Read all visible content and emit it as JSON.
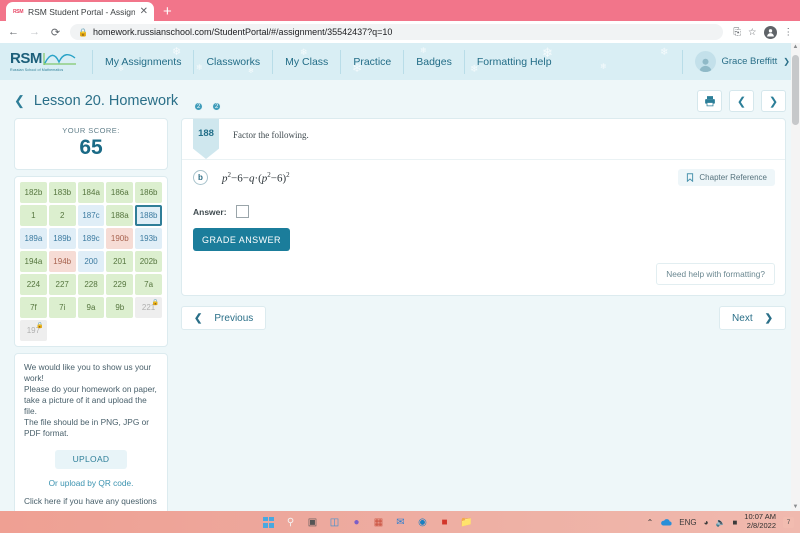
{
  "browser": {
    "tab_title": "RSM Student Portal - Assignment",
    "tab_favicon_text": "RSM",
    "tab_close_glyph": "✕",
    "new_tab_glyph": "+",
    "back_glyph": "←",
    "forward_glyph": "→",
    "reload_glyph": "⟳",
    "lock_glyph": "🔒",
    "url": "homework.russianschool.com/StudentPortal/#/assignment/35542437?q=10",
    "share_glyph": "⎘",
    "bookmark_glyph": "☆",
    "menu_glyph": "⋮"
  },
  "site_nav": {
    "logo_main": "RSM",
    "logo_sub": "Russian School of Mathematics",
    "links": [
      {
        "label": "My Assignments"
      },
      {
        "label": "Classworks"
      },
      {
        "label": "My Class"
      },
      {
        "label": "Practice"
      },
      {
        "label": "Badges"
      },
      {
        "label": "Formatting Help"
      }
    ],
    "user_name": "Grace Breffitt",
    "user_caret": "❯"
  },
  "lesson": {
    "back_glyph": "❮",
    "title": "Lesson 20. Homework",
    "badge_counts": [
      "2",
      "2"
    ],
    "print_label": "print-icon",
    "prev_glyph": "❮",
    "next_glyph": "❯"
  },
  "score": {
    "label": "YOUR SCORE:",
    "value": "65"
  },
  "problem_grid": [
    {
      "label": "182b",
      "state": "green"
    },
    {
      "label": "183b",
      "state": "green"
    },
    {
      "label": "184a",
      "state": "green"
    },
    {
      "label": "186a",
      "state": "green"
    },
    {
      "label": "186b",
      "state": "green"
    },
    {
      "label": "1",
      "state": "green"
    },
    {
      "label": "2",
      "state": "green"
    },
    {
      "label": "187c",
      "state": "blue"
    },
    {
      "label": "188a",
      "state": "green"
    },
    {
      "label": "188b",
      "state": "blue",
      "selected": true
    },
    {
      "label": "189a",
      "state": "blue"
    },
    {
      "label": "189b",
      "state": "blue"
    },
    {
      "label": "189c",
      "state": "blue"
    },
    {
      "label": "190b",
      "state": "pink"
    },
    {
      "label": "193b",
      "state": "blue"
    },
    {
      "label": "194a",
      "state": "green"
    },
    {
      "label": "194b",
      "state": "pink"
    },
    {
      "label": "200",
      "state": "blue"
    },
    {
      "label": "201",
      "state": "green"
    },
    {
      "label": "202b",
      "state": "green"
    },
    {
      "label": "224",
      "state": "green"
    },
    {
      "label": "227",
      "state": "green"
    },
    {
      "label": "228",
      "state": "green"
    },
    {
      "label": "229",
      "state": "green"
    },
    {
      "label": "7a",
      "state": "green"
    },
    {
      "label": "7f",
      "state": "green"
    },
    {
      "label": "7i",
      "state": "green"
    },
    {
      "label": "9a",
      "state": "green"
    },
    {
      "label": "9b",
      "state": "green"
    },
    {
      "label": "221",
      "state": "lock",
      "locked": true
    },
    {
      "label": "197",
      "state": "lock",
      "locked": true
    }
  ],
  "upload_panel": {
    "lines": [
      "We would like you to show us your work!",
      "Please do your homework on paper, take a picture of it and upload the file.",
      "The file should be in PNG, JPG or PDF format."
    ],
    "upload_button": "UPLOAD",
    "qr_link": "Or upload by QR code.",
    "cut_line": "Click here if you have any questions"
  },
  "problem": {
    "number": "188",
    "statement": "Factor the following.",
    "part_letter": "b",
    "expression": {
      "base1": "p",
      "exp1": "2",
      "op1": "−",
      "const1": "6",
      "op2": "−",
      "var2": "q",
      "dot": "·",
      "open": "(",
      "base2": "p",
      "exp2": "2",
      "op3": "−",
      "const2": "6",
      "close": ")",
      "exp3": "2"
    },
    "chapter_reference": "Chapter Reference",
    "answer_label": "Answer:",
    "answer_value": "",
    "grade_button": "GRADE ANSWER",
    "format_help": "Need help with formatting?"
  },
  "pager": {
    "previous": "Previous",
    "next": "Next",
    "prev_glyph": "❮",
    "next_glyph": "❯"
  },
  "taskbar": {
    "language": "ENG",
    "time": "10:07 AM",
    "date": "2/8/2022",
    "notification_count": "7",
    "up_arrow": "⌃",
    "wifi_glyph": "📶",
    "volume_glyph": "🔇",
    "battery_glyph": "▭"
  },
  "colors": {
    "brand_teal": "#1b7d9b",
    "nav_bg": "#d9eef4",
    "page_bg": "#eef7f9",
    "correct_green": "#dcefcf",
    "inprogress_blue": "#e0eef7",
    "incorrect_pink": "#f6dcd5",
    "locked_gray": "#eeeeee"
  }
}
